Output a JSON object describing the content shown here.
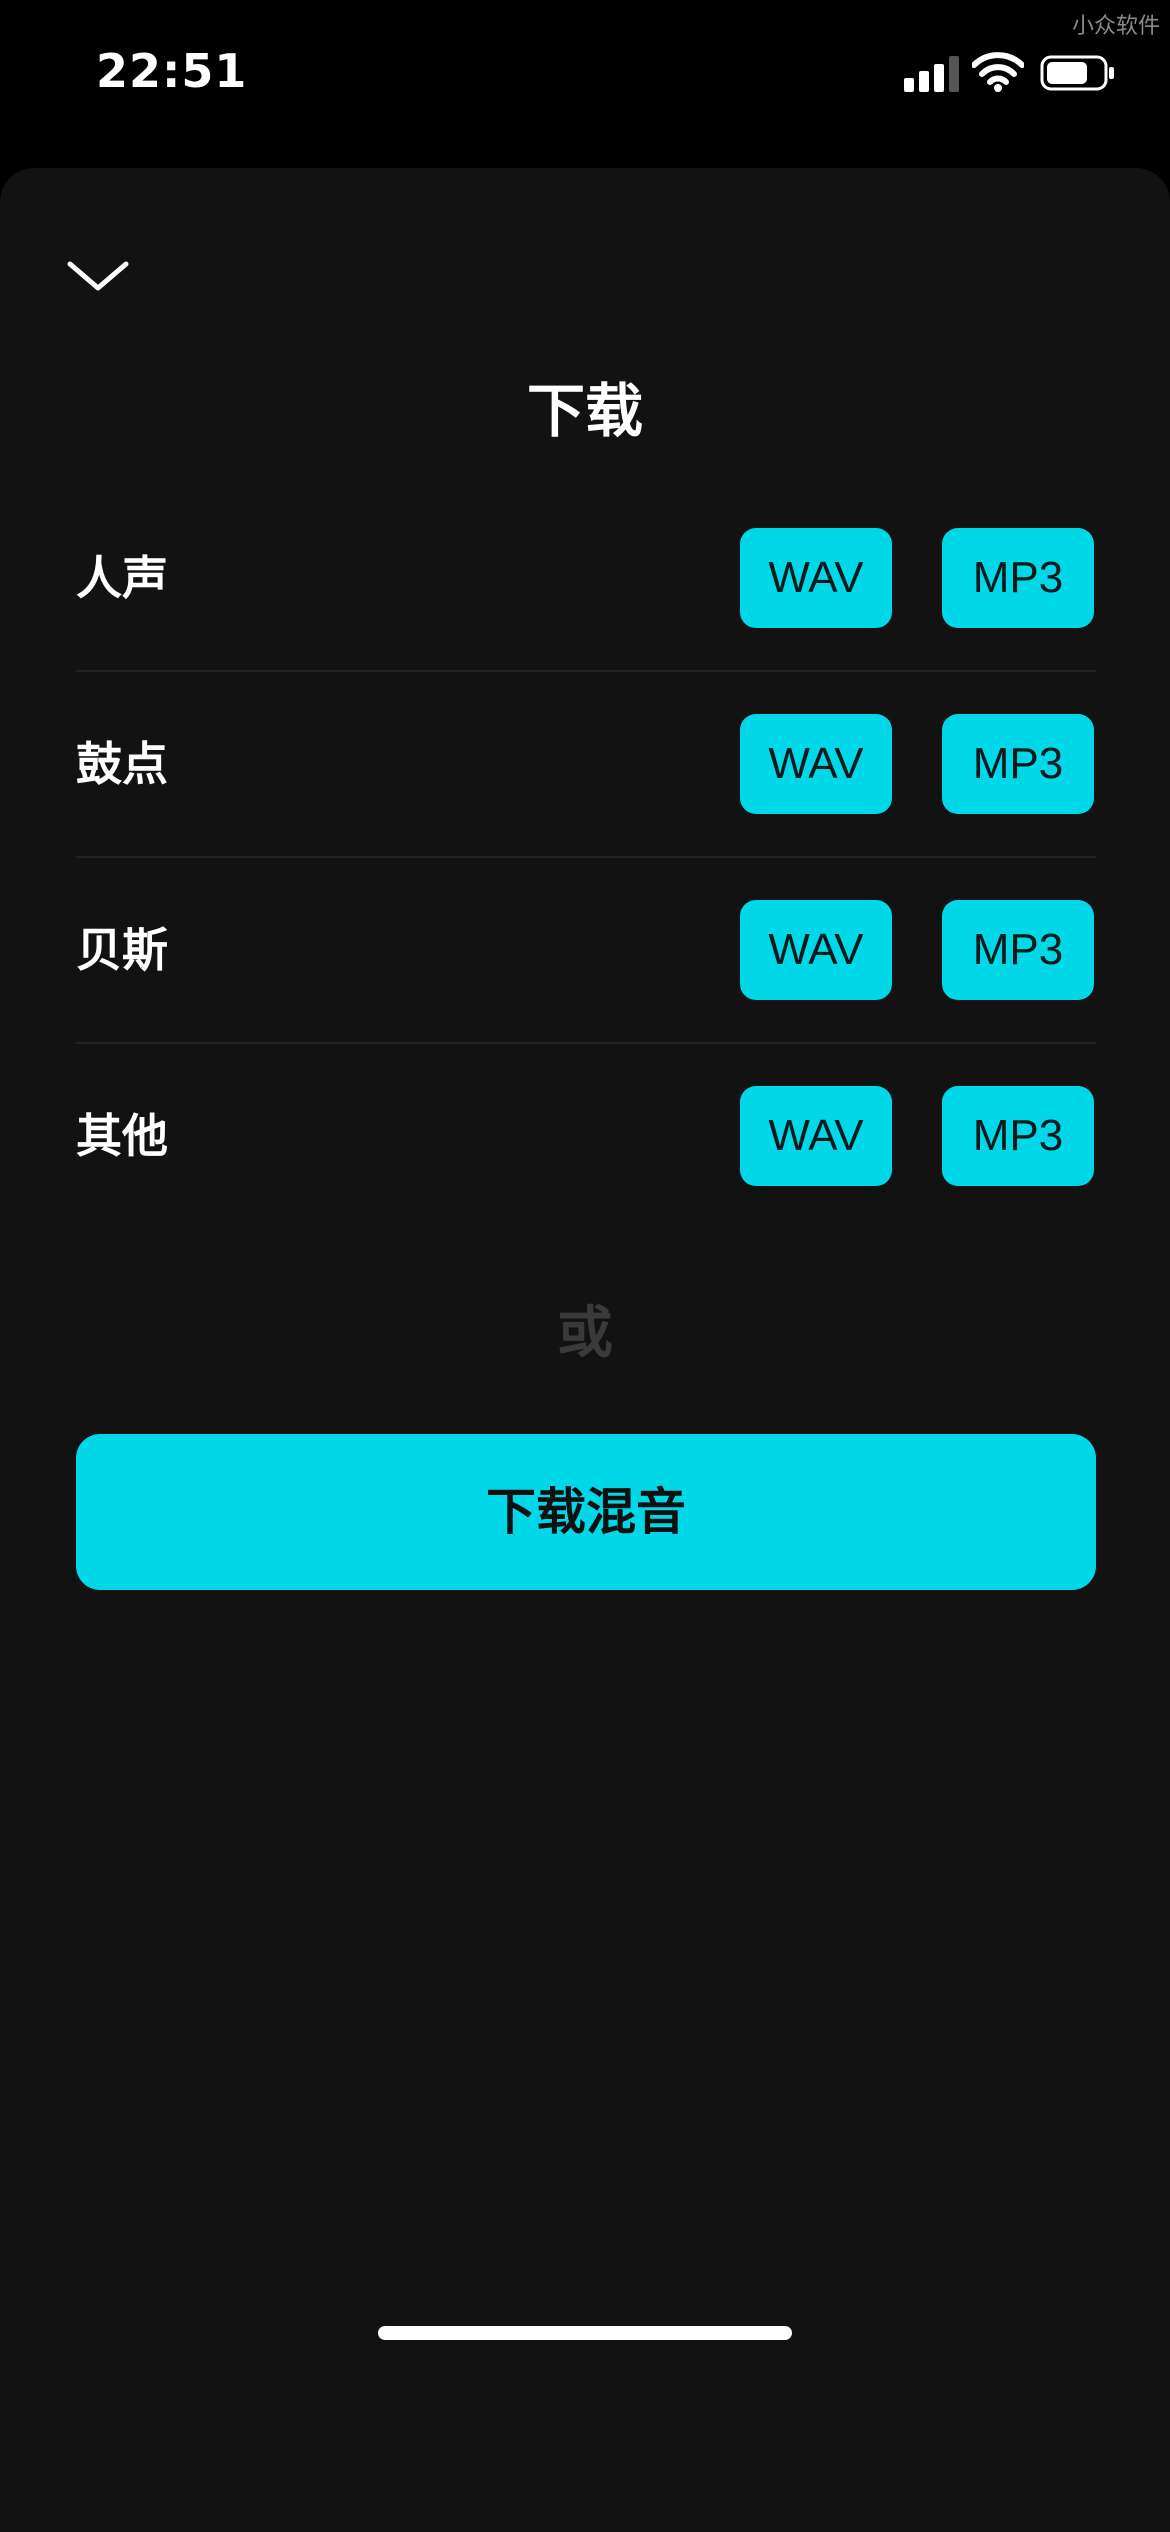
{
  "status_bar": {
    "time": "22:51",
    "watermark": "小众软件",
    "icons": [
      "signal-icon",
      "wifi-icon",
      "battery-icon"
    ]
  },
  "sheet": {
    "collapse_icon": "chevron-down-icon",
    "title": "下载",
    "tracks": [
      {
        "label": "人声",
        "formats": [
          "WAV",
          "MP3"
        ]
      },
      {
        "label": "鼓点",
        "formats": [
          "WAV",
          "MP3"
        ]
      },
      {
        "label": "贝斯",
        "formats": [
          "WAV",
          "MP3"
        ]
      },
      {
        "label": "其他",
        "formats": [
          "WAV",
          "MP3"
        ]
      }
    ],
    "or_label": "或",
    "mix_button_label": "下载混音"
  },
  "colors": {
    "accent": "#00d8e8",
    "sheet_background": "#121212",
    "page_background": "#000000",
    "divider": "#232323",
    "muted_text": "#3a3a3a"
  }
}
